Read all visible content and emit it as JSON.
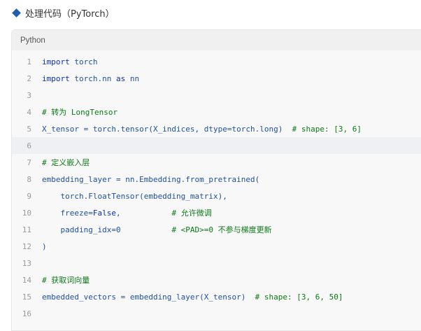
{
  "title": {
    "text": "处理代码（PyTorch）",
    "icon": "diamond-icon",
    "icon_color": "#1f5fae"
  },
  "code_block": {
    "language": "Python",
    "highlighted_line": 6,
    "lines": [
      {
        "n": "1",
        "tokens": [
          {
            "t": "import",
            "c": "kw"
          },
          {
            "t": " torch",
            "c": "plain"
          }
        ]
      },
      {
        "n": "2",
        "tokens": [
          {
            "t": "import",
            "c": "kw"
          },
          {
            "t": " torch.nn ",
            "c": "plain"
          },
          {
            "t": "as",
            "c": "kw"
          },
          {
            "t": " nn",
            "c": "plain"
          }
        ]
      },
      {
        "n": "3",
        "tokens": []
      },
      {
        "n": "4",
        "tokens": [
          {
            "t": "# 转为 LongTensor",
            "c": "cmt"
          }
        ]
      },
      {
        "n": "5",
        "tokens": [
          {
            "t": "X_tensor = torch.tensor(X_indices, dtype=torch.long)  ",
            "c": "plain"
          },
          {
            "t": "# shape: [3, 6]",
            "c": "cmt"
          }
        ]
      },
      {
        "n": "6",
        "tokens": []
      },
      {
        "n": "7",
        "tokens": [
          {
            "t": "# 定义嵌入层",
            "c": "cmt"
          }
        ]
      },
      {
        "n": "8",
        "tokens": [
          {
            "t": "embedding_layer = nn.Embedding.from_pretrained(",
            "c": "plain"
          }
        ]
      },
      {
        "n": "9",
        "tokens": [
          {
            "t": "    torch.FloatTensor(embedding_matrix),",
            "c": "plain"
          }
        ]
      },
      {
        "n": "10",
        "tokens": [
          {
            "t": "    freeze=",
            "c": "plain"
          },
          {
            "t": "False",
            "c": "kw"
          },
          {
            "t": ",           ",
            "c": "plain"
          },
          {
            "t": "# 允许微调",
            "c": "cmt"
          }
        ]
      },
      {
        "n": "11",
        "tokens": [
          {
            "t": "    padding_idx=0           ",
            "c": "plain"
          },
          {
            "t": "# <PAD>=0 不参与梯度更新",
            "c": "cmt"
          }
        ]
      },
      {
        "n": "12",
        "tokens": [
          {
            "t": ")",
            "c": "plain"
          }
        ]
      },
      {
        "n": "13",
        "tokens": []
      },
      {
        "n": "14",
        "tokens": [
          {
            "t": "# 获取词向量",
            "c": "cmt"
          }
        ]
      },
      {
        "n": "15",
        "tokens": [
          {
            "t": "embedded_vectors = embedding_layer(X_tensor)  ",
            "c": "plain"
          },
          {
            "t": "# shape: [3, 6, 50]",
            "c": "cmt"
          }
        ]
      },
      {
        "n": "16",
        "tokens": []
      }
    ]
  }
}
